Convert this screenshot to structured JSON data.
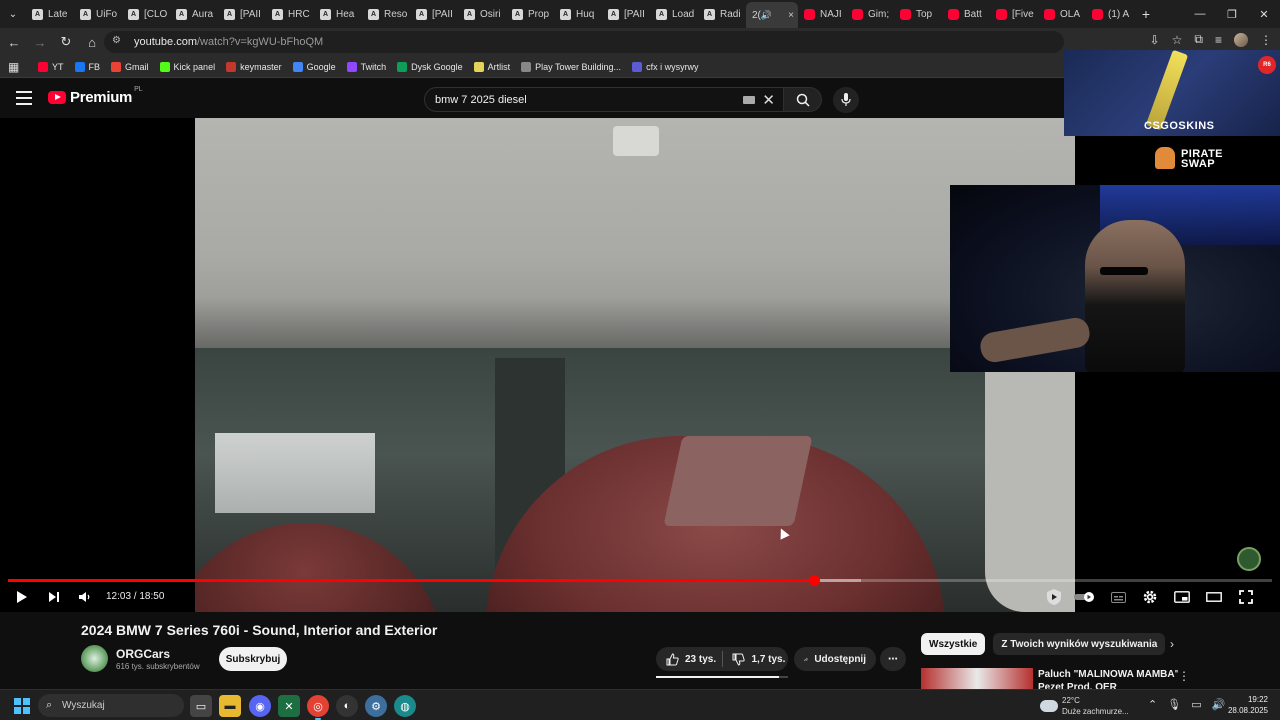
{
  "browser": {
    "tabs": [
      {
        "label": "Late",
        "favicon": "A"
      },
      {
        "label": "UiFo",
        "favicon": "A"
      },
      {
        "label": "[CLO",
        "favicon": "A"
      },
      {
        "label": "Aura",
        "favicon": "A"
      },
      {
        "label": "[PAII",
        "favicon": "A"
      },
      {
        "label": "HRC",
        "favicon": "A"
      },
      {
        "label": "Hea",
        "favicon": "A"
      },
      {
        "label": "Reso",
        "favicon": "A"
      },
      {
        "label": "[PAII",
        "favicon": "A"
      },
      {
        "label": "Osiri",
        "favicon": "A"
      },
      {
        "label": "Prop",
        "favicon": "A"
      },
      {
        "label": "Huq",
        "favicon": "A"
      },
      {
        "label": "[PAII",
        "favicon": "A"
      },
      {
        "label": "Load",
        "favicon": "A"
      },
      {
        "label": "Radi",
        "favicon": "A"
      }
    ],
    "active_tab": {
      "label": "2(",
      "close": "×"
    },
    "yt_tabs": [
      {
        "label": "NAJI"
      },
      {
        "label": "Gim;"
      },
      {
        "label": "Top"
      },
      {
        "label": "Batt"
      },
      {
        "label": "[Five"
      },
      {
        "label": "OLA"
      },
      {
        "label": "(1) A"
      }
    ],
    "new_tab": "+",
    "url": {
      "host": "youtube.com",
      "path": "/watch?v=kgWU-bFhoQM"
    },
    "bookmarks": [
      {
        "label": "YT",
        "icon": "youtube-icon",
        "color": "#ff0033"
      },
      {
        "label": "FB",
        "icon": "facebook-icon",
        "color": "#1877f2"
      },
      {
        "label": "Gmail",
        "icon": "gmail-icon",
        "color": "#ea4335"
      },
      {
        "label": "Kick panel",
        "icon": "kick-icon",
        "color": "#53fc18"
      },
      {
        "label": "keymaster",
        "icon": "keymaster-icon",
        "color": "#c0392b"
      },
      {
        "label": "Google",
        "icon": "google-icon",
        "color": "#4285f4"
      },
      {
        "label": "Twitch",
        "icon": "twitch-icon",
        "color": "#9146ff"
      },
      {
        "label": "Dysk Google",
        "icon": "drive-icon",
        "color": "#0f9d58"
      },
      {
        "label": "Artlist",
        "icon": "artlist-icon",
        "color": "#e6d35a"
      },
      {
        "label": "Play Tower Building...",
        "icon": "roblox-icon",
        "color": "#888888"
      },
      {
        "label": "cfx i wysyrwy",
        "icon": "cfx-icon",
        "color": "#5b5bd6"
      }
    ]
  },
  "youtube": {
    "logo_text": "Premium",
    "logo_region": "PL",
    "search_query": "bmw 7 2025 diesel",
    "video": {
      "title": "2024 BMW 7 Series 760i - Sound, Interior and Exterior",
      "time_current": "12:03",
      "time_total": "18:50",
      "time_display": "12:03 / 18:50",
      "progress": 0.638,
      "buffered": 0.675
    },
    "channel": {
      "name": "ORGCars",
      "subscribers": "616 tys. subskrybentów",
      "subscribe_label": "Subskrybuj"
    },
    "likes": "23 tys.",
    "dislikes": "1,7 tys.",
    "share_label": "Udostępnij",
    "like_ratio": 0.93,
    "chips": [
      "Wszystkie",
      "Z Twoich wyników wyszukiwania"
    ],
    "recommendation": {
      "title_line1": "Paluch \"MALINOWA MAMBA\" ft.",
      "title_line2": "Pezet Prod. OER"
    }
  },
  "overlays": {
    "csgo_label": "CSGOSKINS",
    "pirate_line1": "PIRATE",
    "pirate_line2": "SWAP",
    "badge": "R6"
  },
  "taskbar": {
    "search_placeholder": "Wyszukaj",
    "weather_temp": "22°C",
    "weather_desc": "Duże zachmurze...",
    "time": "19:22",
    "date": "28.08.2025"
  },
  "colors": {
    "accent": "#ff0000",
    "brand": "#ff0033",
    "taskbar_accent": "#4cc2ff"
  }
}
